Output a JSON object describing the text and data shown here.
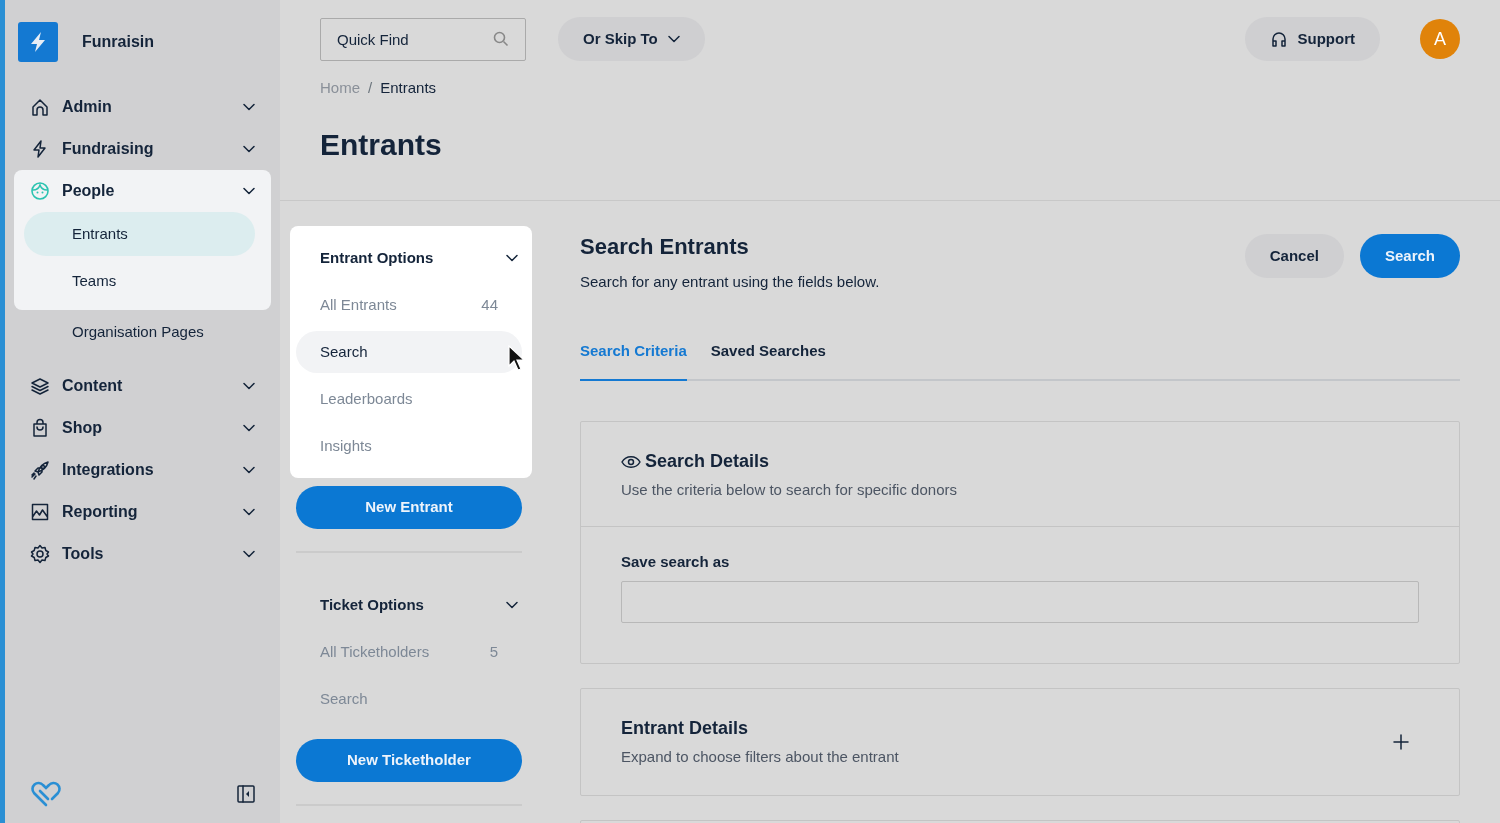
{
  "app": {
    "name": "Funraisin"
  },
  "sidebar": {
    "items": [
      {
        "label": "Admin"
      },
      {
        "label": "Fundraising"
      },
      {
        "label": "People",
        "expanded": true,
        "highlighted": true,
        "children": [
          {
            "label": "Entrants",
            "selected": true,
            "highlighted": true
          },
          {
            "label": "Teams",
            "selected": false,
            "highlighted": true
          },
          {
            "label": "Organisation Pages",
            "selected": false,
            "highlighted": false
          }
        ]
      },
      {
        "label": "Content"
      },
      {
        "label": "Shop"
      },
      {
        "label": "Integrations"
      },
      {
        "label": "Reporting"
      },
      {
        "label": "Tools"
      }
    ]
  },
  "topbar": {
    "search": {
      "placeholder": "Quick Find"
    },
    "skip_button": "Or Skip To",
    "support_button": "Support",
    "avatar": "A"
  },
  "breadcrumb": [
    "Home",
    "Entrants"
  ],
  "breadcrumb_separator": "/",
  "page_title": "Entrants",
  "option_panels": [
    {
      "title": "Entrant Options",
      "highlighted": true,
      "items": [
        {
          "label": "All Entrants",
          "count": "44",
          "selected": false
        },
        {
          "label": "Search",
          "selected": true
        },
        {
          "label": "Leaderboards",
          "selected": false
        },
        {
          "label": "Insights",
          "selected": false
        }
      ],
      "button": "New Entrant"
    },
    {
      "title": "Ticket Options",
      "highlighted": false,
      "items": [
        {
          "label": "All Ticketholders",
          "count": "5",
          "selected": false
        },
        {
          "label": "Search",
          "selected": false
        }
      ],
      "button": "New Ticketholder"
    }
  ],
  "content": {
    "title": "Search Entrants",
    "subtitle": "Search for any entrant using the fields below.",
    "buttons": [
      {
        "label": "Cancel",
        "kind": "secondary"
      },
      {
        "label": "Search",
        "kind": "primary"
      }
    ],
    "tabs": [
      {
        "label": "Search Criteria",
        "selected": true
      },
      {
        "label": "Saved Searches",
        "selected": false
      }
    ],
    "sections": [
      {
        "kind": "form",
        "title": "Search Details",
        "description": "Use the criteria below to search for specific donors",
        "fields": [
          {
            "label": "Save search as"
          }
        ]
      },
      {
        "kind": "collapsible",
        "title": "Entrant Details",
        "description": "Expand to choose filters about the entrant",
        "expanded": false
      }
    ]
  }
}
